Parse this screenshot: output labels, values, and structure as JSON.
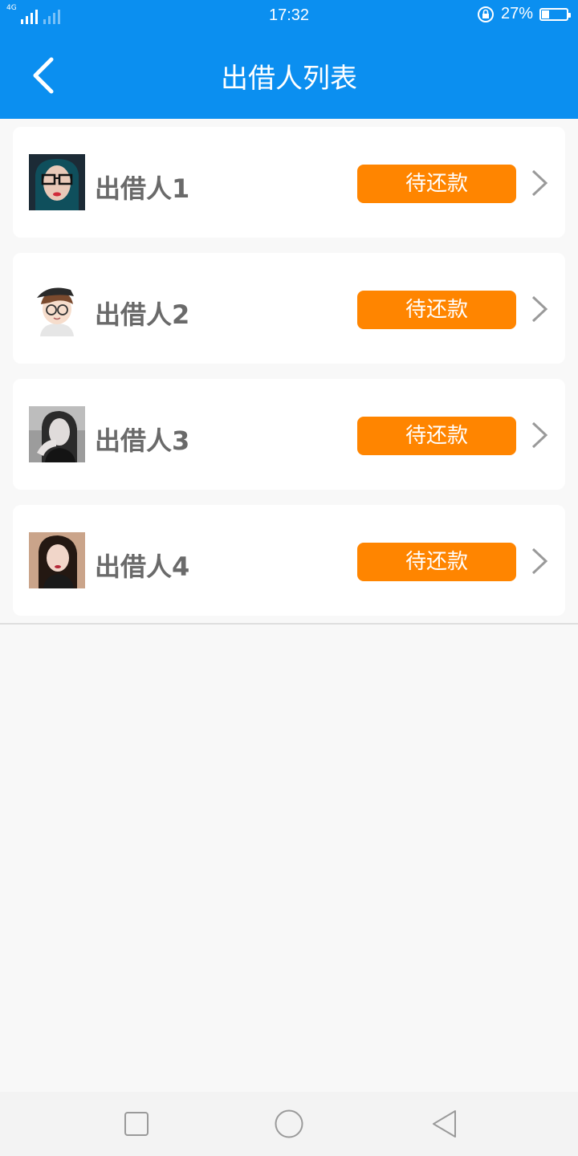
{
  "status_bar": {
    "network_label": "4G",
    "time": "17:32",
    "battery_percent": "27%",
    "battery_level": 0.27
  },
  "header": {
    "title": "出借人列表",
    "back_icon": "chevron-left-icon"
  },
  "colors": {
    "primary_blue": "#0b8ff0",
    "status_orange": "#ff8500",
    "name_gray": "#6a6a6a",
    "page_background": "#f8f8f8"
  },
  "lenders": [
    {
      "name": "出借人1",
      "status": "待还款",
      "avatar": "avatar-woman-glasses"
    },
    {
      "name": "出借人2",
      "status": "待还款",
      "avatar": "avatar-cartoon-boy"
    },
    {
      "name": "出借人3",
      "status": "待还款",
      "avatar": "avatar-woman-grayscale"
    },
    {
      "name": "出借人4",
      "status": "待还款",
      "avatar": "avatar-woman-dark"
    }
  ],
  "nav_bar": {
    "icons": [
      "square-recents-icon",
      "circle-home-icon",
      "triangle-back-icon"
    ]
  }
}
